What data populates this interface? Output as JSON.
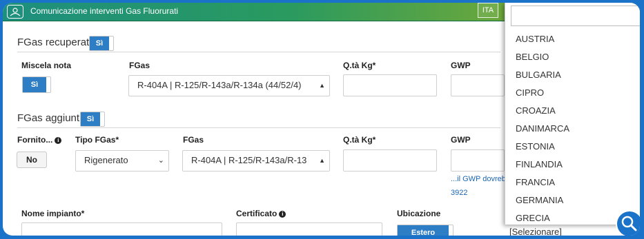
{
  "header": {
    "app_title": "Comunicazione interventi Gas Fluorurati",
    "lang_button": "ITA"
  },
  "recovered": {
    "title": "FGas recuperati",
    "toggle_label": "Sì",
    "mix_label": "Miscela nota",
    "mix_toggle": "Sì",
    "fgas_label": "FGas",
    "fgas_value": "R-404A | R-125/R-143a/R-134a (44/52/4)",
    "qty_label": "Q.tà Kg*",
    "gwp_label": "GWP"
  },
  "added": {
    "title": "FGas aggiunti",
    "toggle_label": "Sì",
    "supplied_label": "Fornito...",
    "supplied_toggle": "No",
    "type_label": "Tipo FGas*",
    "type_value": "Rigenerato",
    "fgas_label": "FGas",
    "fgas_value": "R-404A | R-125/R-143a/R-13",
    "qty_label": "Q.tà Kg*",
    "gwp_label": "GWP",
    "gwp_hint": "...il GWP dovreb",
    "gwp_hint_value": "3922"
  },
  "plant": {
    "name_label": "Nome impianto*",
    "certificate_label": "Certificato",
    "location_label": "Ubicazione",
    "location_toggle": "Estero"
  },
  "dropdown": {
    "search_value": "",
    "options": [
      "AUSTRIA",
      "BELGIO",
      "BULGARIA",
      "CIPRO",
      "CROAZIA",
      "DANIMARCA",
      "ESTONIA",
      "FINLANDIA",
      "FRANCIA",
      "GERMANIA",
      "GRECIA"
    ],
    "selected": "[Selezionare]"
  },
  "colors": {
    "accent": "#2d7ec4",
    "frame": "#1a73c8",
    "header_start": "#1d8f7e",
    "header_end": "#98b436"
  },
  "icons": {
    "logo": "home-logo-icon",
    "info": "info-icon",
    "search": "magnifier-icon",
    "select_arrow": "triangle-up-icon",
    "chevron": "chevron-down-icon"
  }
}
